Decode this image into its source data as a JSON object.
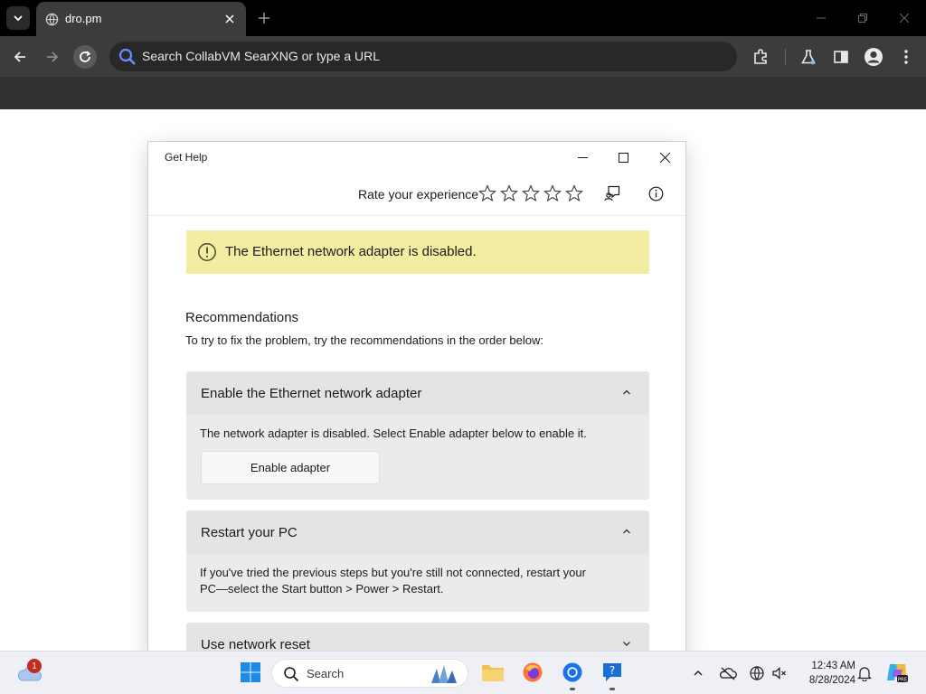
{
  "browser": {
    "tab": {
      "title": "dro.pm"
    },
    "address_bar": {
      "placeholder": "Search CollabVM SearXNG or type a URL"
    }
  },
  "dialog": {
    "title": "Get Help",
    "rate_label": "Rate your experience",
    "stars": 5,
    "banner": {
      "text": "The Ethernet network adapter is disabled.",
      "color": "#f3eda1"
    },
    "recommendations": {
      "title": "Recommendations",
      "subtitle": "To try to fix the problem, try the recommendations in the order below:"
    },
    "cards": [
      {
        "title": "Enable the Ethernet network adapter",
        "text": "The network adapter is disabled. Select Enable adapter below to enable it.",
        "button": "Enable adapter",
        "expanded": true
      },
      {
        "title": "Restart your PC",
        "text_line1": "If you've tried the previous steps but you're still not connected, restart your",
        "text_line2": "PC—select the Start button > Power > Restart.",
        "expanded": true
      },
      {
        "title": "Use network reset",
        "expanded": false
      }
    ]
  },
  "taskbar": {
    "search_label": "Search",
    "weather_badge": "1",
    "clock": {
      "time": "12:43 AM",
      "date": "8/28/2024"
    }
  }
}
